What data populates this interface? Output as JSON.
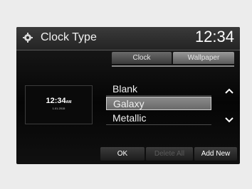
{
  "header": {
    "title": "Clock Type",
    "clock": "12:34",
    "icon": "gear-icon"
  },
  "tabs": [
    {
      "label": "Clock",
      "selected": false
    },
    {
      "label": "Wallpaper",
      "selected": true
    }
  ],
  "preview": {
    "time": "12:34",
    "time_suffix": "AM",
    "date": "1.01.2015"
  },
  "wallpaper_list": {
    "items": [
      {
        "label": "Blank",
        "selected": false
      },
      {
        "label": "Galaxy",
        "selected": true
      },
      {
        "label": "Metallic",
        "selected": false
      }
    ],
    "scroll_up_icon": "chevron-up-icon",
    "scroll_down_icon": "chevron-down-icon"
  },
  "buttons": {
    "ok": "OK",
    "delete_all": "Delete All",
    "add_new": "Add New"
  }
}
